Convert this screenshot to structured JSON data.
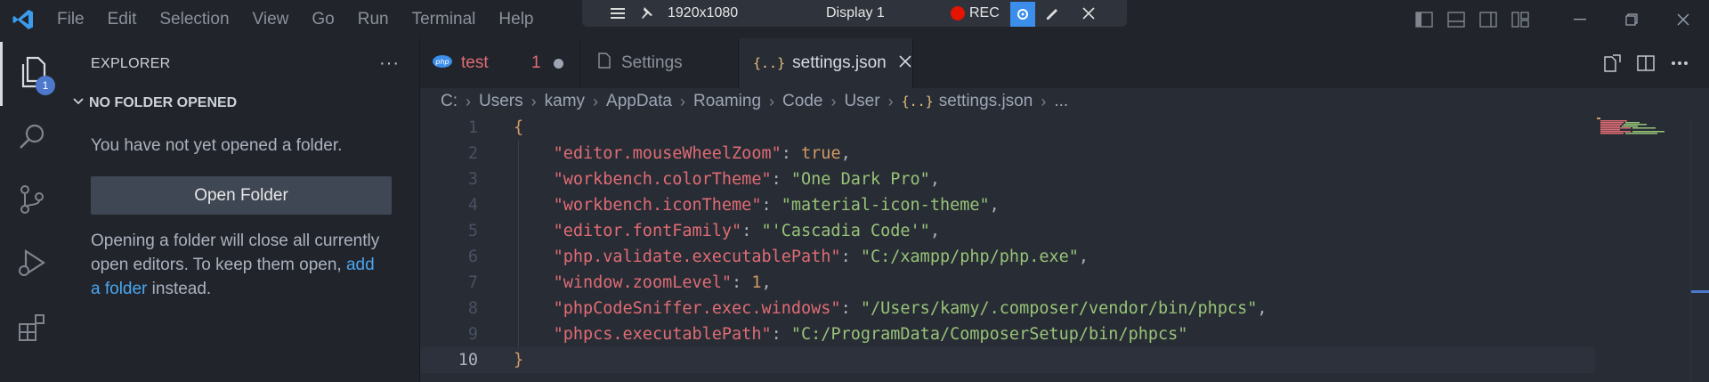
{
  "titlebar": {
    "menu": [
      "File",
      "Edit",
      "Selection",
      "View",
      "Go",
      "Run",
      "Terminal",
      "Help"
    ],
    "recorder": {
      "resolution": "1920x1080",
      "display": "Display 1",
      "rec_label": "REC"
    }
  },
  "activity": {
    "explorer_badge": "1"
  },
  "sidebar": {
    "title": "EXPLORER",
    "section": "NO FOLDER OPENED",
    "message": "You have not yet opened a folder.",
    "open_folder_button": "Open Folder",
    "info_line1": "Opening a folder will close all currently",
    "info_line2_a": "open editors. To keep them open,",
    "info_link_a": "add",
    "info_link_b": "a folder",
    "info_line3_b": "instead."
  },
  "tabs": [
    {
      "icon": "php",
      "label": "test",
      "problems": "1",
      "dirty": true,
      "active": false
    },
    {
      "icon": "file",
      "label": "Settings",
      "active": false
    },
    {
      "icon": "json",
      "label": "settings.json",
      "active": true
    }
  ],
  "breadcrumb": [
    "C:",
    "Users",
    "kamy",
    "AppData",
    "Roaming",
    "Code",
    "User",
    "settings.json",
    "..."
  ],
  "editor": {
    "line_numbers": [
      "1",
      "2",
      "3",
      "4",
      "5",
      "6",
      "7",
      "8",
      "9",
      "10"
    ],
    "settings": [
      {
        "key": "\"editor.mouseWheelZoom\"",
        "value": "true",
        "type": "bool",
        "comma": ","
      },
      {
        "key": "\"workbench.colorTheme\"",
        "value": "\"One Dark Pro\"",
        "type": "str",
        "comma": ","
      },
      {
        "key": "\"workbench.iconTheme\"",
        "value": "\"material-icon-theme\"",
        "type": "str",
        "comma": ","
      },
      {
        "key": "\"editor.fontFamily\"",
        "value": "\"'Cascadia Code'\"",
        "type": "str",
        "comma": ","
      },
      {
        "key": "\"php.validate.executablePath\"",
        "value": "\"C:/xampp/php/php.exe\"",
        "type": "str",
        "comma": ","
      },
      {
        "key": "\"window.zoomLevel\"",
        "value": "1",
        "type": "num",
        "comma": ","
      },
      {
        "key": "\"phpCodeSniffer.exec.windows\"",
        "value": "\"/Users/kamy/.composer/vendor/bin/phpcs\"",
        "type": "str",
        "comma": ","
      },
      {
        "key": "\"phpcs.executablePath\"",
        "value": "\"C:/ProgramData/ComposerSetup/bin/phpcs\"",
        "type": "str",
        "comma": ""
      }
    ],
    "open_brace": "{",
    "close_brace": "}"
  },
  "colors": {
    "accent": "#4d78cc",
    "rec": "#e51400",
    "key": "#e06c75",
    "string": "#98c379",
    "number": "#d19a66"
  }
}
